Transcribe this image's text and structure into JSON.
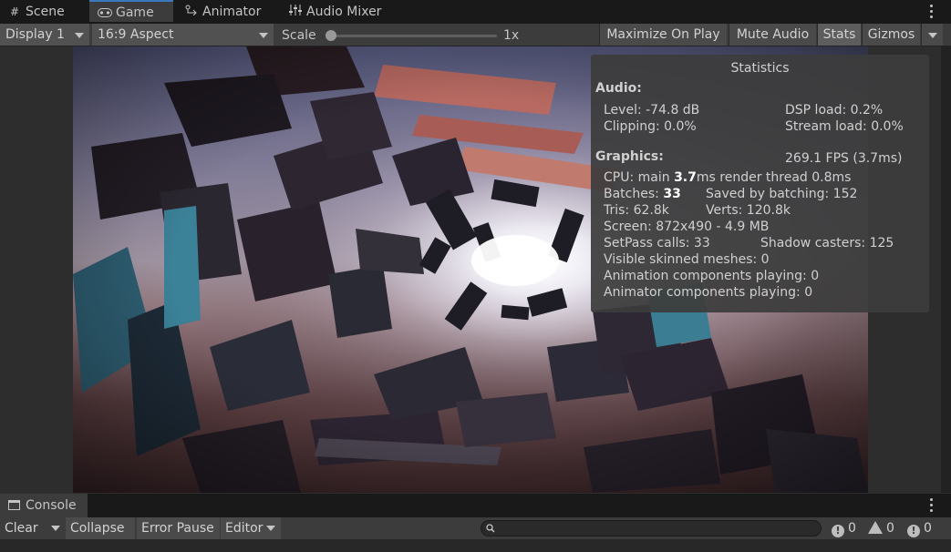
{
  "tabs": [
    {
      "label": "Scene",
      "icon": "grid-icon"
    },
    {
      "label": "Game",
      "icon": "gamepad-icon"
    },
    {
      "label": "Animator",
      "icon": "animator-icon"
    },
    {
      "label": "Audio Mixer",
      "icon": "sliders-icon"
    }
  ],
  "toolbar": {
    "display": "Display 1",
    "aspect": "16:9 Aspect",
    "scale_label": "Scale",
    "scale_value": "1x",
    "scale_fraction": 0.0,
    "maximize": "Maximize On Play",
    "mute": "Mute Audio",
    "stats": "Stats",
    "gizmos": "Gizmos"
  },
  "stats": {
    "title": "Statistics",
    "audio_header": "Audio:",
    "level": "Level: -74.8 dB",
    "dsp": "DSP load: 0.2%",
    "clipping": "Clipping: 0.0%",
    "stream": "Stream load: 0.0%",
    "graphics_header": "Graphics:",
    "fps": "269.1 FPS (3.7ms)",
    "cpu_prefix": "CPU: main ",
    "cpu_main": "3.7",
    "cpu_suffix": "ms  render thread 0.8ms",
    "batches_prefix": "Batches: ",
    "batches": "33",
    "saved": "Saved by batching: 152",
    "tris": "Tris: 62.8k",
    "verts": "Verts: 120.8k",
    "screen": "Screen: 872x490 - 4.9 MB",
    "setpass": "SetPass calls: 33",
    "shadow": "Shadow casters: 125",
    "skinned": "Visible skinned meshes: 0",
    "anim": "Animation components playing: 0",
    "animator": "Animator components playing: 0"
  },
  "console": {
    "tab": "Console",
    "clear": "Clear",
    "collapse": "Collapse",
    "error_pause": "Error Pause",
    "editor": "Editor",
    "info_count": "0",
    "warn_count": "0",
    "error_count": "0"
  },
  "colors": {
    "accent": "#3a79bb",
    "panel": "#3c3c3c",
    "dark": "#191919"
  }
}
